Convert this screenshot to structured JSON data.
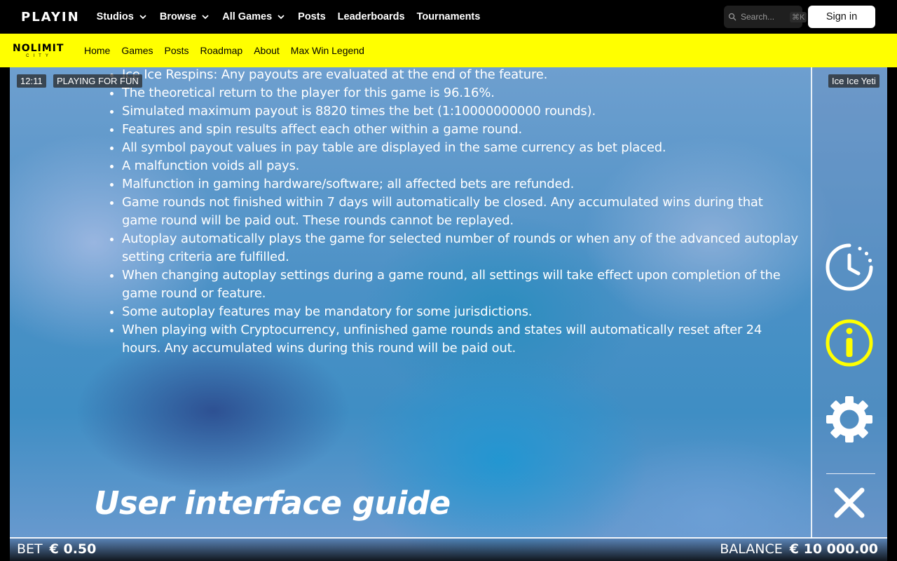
{
  "site": {
    "logo": "PLAYIN",
    "nav": [
      {
        "label": "Studios",
        "dropdown": true
      },
      {
        "label": "Browse",
        "dropdown": true
      },
      {
        "label": "All Games",
        "dropdown": true
      },
      {
        "label": "Posts",
        "dropdown": false
      },
      {
        "label": "Leaderboards",
        "dropdown": false
      },
      {
        "label": "Tournaments",
        "dropdown": false
      }
    ],
    "search_placeholder": "Search...",
    "search_shortcut": "⌘K",
    "signin": "Sign in"
  },
  "studio": {
    "logo_main": "NOLIMIT",
    "logo_sub": "CITY",
    "nav": [
      "Home",
      "Games",
      "Posts",
      "Roadmap",
      "About",
      "Max Win Legend"
    ],
    "accent_color": "#ffff00"
  },
  "game": {
    "time": "12:11",
    "mode": "PLAYING FOR FUN",
    "title": "Ice Ice Yeti",
    "rules": [
      "Ice Ice Respins: Any payouts are evaluated at the end of the feature.",
      "The theoretical return to the player for this game is 96.16%.",
      "Simulated maximum payout is 8820 times the bet (1:10000000000 rounds).",
      "Features and spin results affect each other within a game round.",
      "All symbol payout values in pay table are displayed in the same currency as bet placed.",
      "A malfunction voids all pays.",
      "Malfunction in gaming hardware/software; all affected bets are refunded.",
      "Game rounds not finished within 7 days will automatically be closed. Any accumulated wins during that game round will be paid out. These rounds cannot be replayed.",
      "Autoplay automatically plays the game for selected number of rounds or when any of the advanced autoplay setting criteria are fulfilled.",
      "When changing autoplay settings during a game round, all settings will take effect upon completion of the game round or feature.",
      "Some autoplay features may be mandatory for some jurisdictions.",
      "When playing with Cryptocurrency, unfinished game rounds and states will automatically reset after 24 hours. Any accumulated wins during this round will be paid out."
    ],
    "guide_title": "User interface guide",
    "side_buttons": [
      "history-icon",
      "info-icon",
      "settings-icon",
      "close-icon"
    ],
    "info_color": "#ffff00",
    "bet_label": "BET",
    "bet_value": "€ 0.50",
    "balance_label": "BALANCE",
    "balance_value": "€ 10 000.00"
  }
}
